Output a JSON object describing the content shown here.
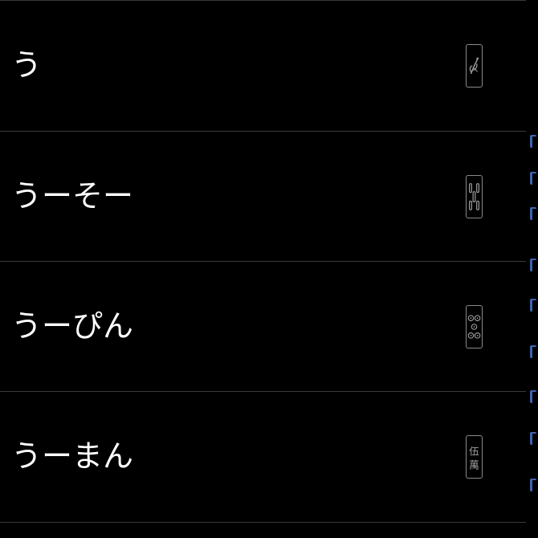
{
  "list": {
    "items": [
      {
        "label": "う",
        "tile": "bird-tile-icon"
      },
      {
        "label": "うーそー",
        "tile": "bamboo-tile-icon"
      },
      {
        "label": "うーぴん",
        "tile": "circle-tile-icon"
      },
      {
        "label": "うーまん",
        "tile": "character-tile-icon",
        "tile_text_top": "伍",
        "tile_text_bottom": "萬"
      }
    ]
  },
  "colors": {
    "background": "#000000",
    "text": "#ffffff",
    "divider": "#3a3a3a",
    "tile_border": "#8a8a8a",
    "edge_accent": "#3f63b0"
  }
}
